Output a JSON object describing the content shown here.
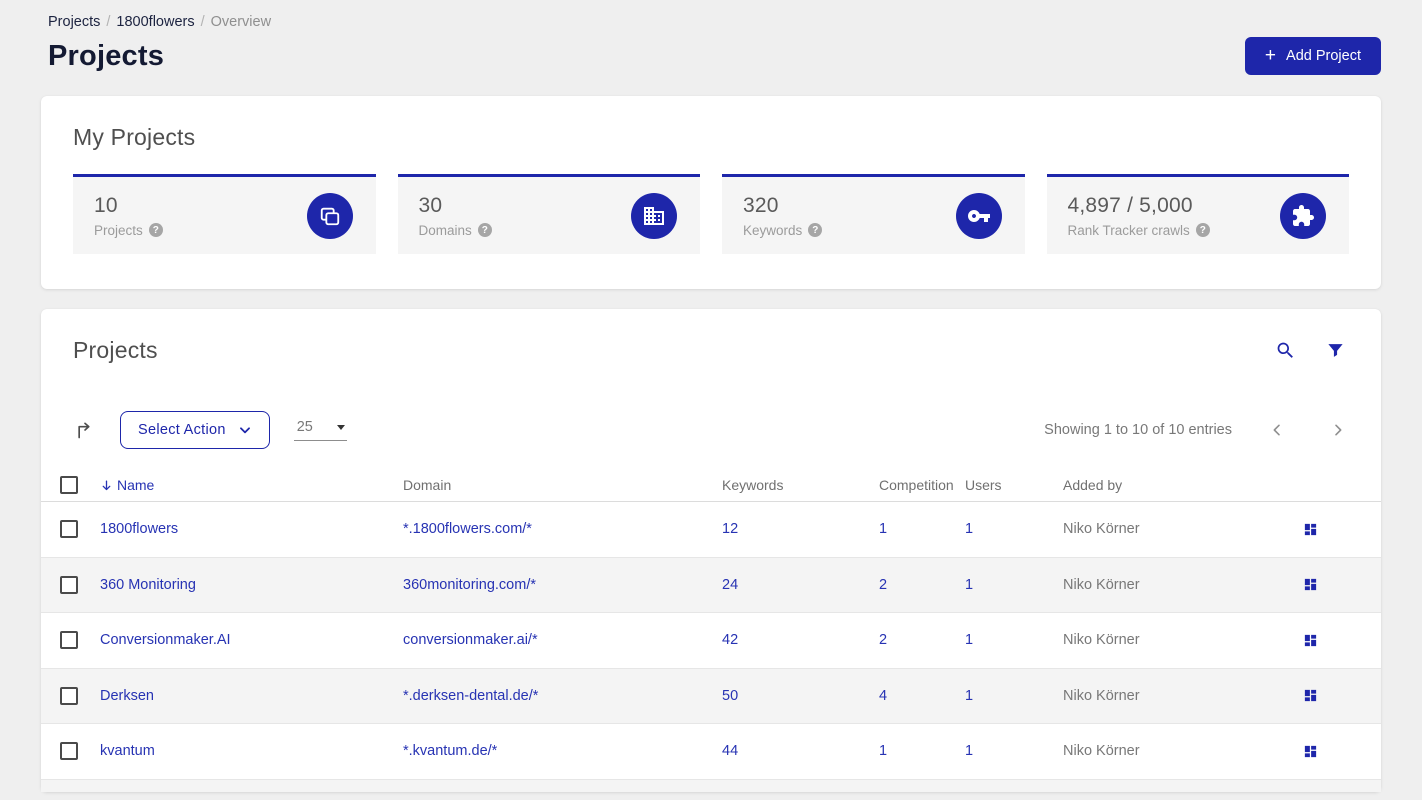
{
  "breadcrumb": {
    "items": [
      "Projects",
      "1800flowers",
      "Overview"
    ],
    "separator": "/"
  },
  "header": {
    "title": "Projects",
    "add_button_label": "Add Project",
    "plus_glyph": "+"
  },
  "my_projects": {
    "title": "My Projects",
    "stats": [
      {
        "value": "10",
        "label": "Projects",
        "icon": "copy-stack-icon"
      },
      {
        "value": "30",
        "label": "Domains",
        "icon": "building-icon"
      },
      {
        "value": "320",
        "label": "Keywords",
        "icon": "key-icon"
      },
      {
        "value": "4,897 / 5,000",
        "label": "Rank Tracker crawls",
        "icon": "puzzle-icon"
      }
    ],
    "help_glyph": "?"
  },
  "projects_panel": {
    "title": "Projects",
    "icons": [
      "search-icon",
      "filter-icon"
    ],
    "toolbar": {
      "export_icon": "export-arrow-icon",
      "select_action_label": "Select Action",
      "page_size_value": "25",
      "showing_text": "Showing 1 to 10 of 10 entries"
    },
    "table": {
      "columns": {
        "name": "Name",
        "domain": "Domain",
        "keywords": "Keywords",
        "competition": "Competition",
        "users": "Users",
        "added_by": "Added by"
      },
      "sort": {
        "column": "Name",
        "direction": "desc"
      },
      "rows": [
        {
          "name": "1800flowers",
          "domain": "*.1800flowers.com/*",
          "keywords": "12",
          "competition": "1",
          "users": "1",
          "added_by": "Niko Körner"
        },
        {
          "name": "360 Monitoring",
          "domain": "360monitoring.com/*",
          "keywords": "24",
          "competition": "2",
          "users": "1",
          "added_by": "Niko Körner"
        },
        {
          "name": "Conversionmaker.AI",
          "domain": "conversionmaker.ai/*",
          "keywords": "42",
          "competition": "2",
          "users": "1",
          "added_by": "Niko Körner"
        },
        {
          "name": "Derksen",
          "domain": "*.derksen-dental.de/*",
          "keywords": "50",
          "competition": "4",
          "users": "1",
          "added_by": "Niko Körner"
        },
        {
          "name": "kvantum",
          "domain": "*.kvantum.de/*",
          "keywords": "44",
          "competition": "1",
          "users": "1",
          "added_by": "Niko Körner"
        }
      ]
    }
  },
  "colors": {
    "brand_blue": "#1e26aa",
    "link_blue": "#2733b3",
    "page_background": "#efefef",
    "stat_box_background": "#f5f5f5",
    "alt_row_background": "#f4f4f4"
  }
}
